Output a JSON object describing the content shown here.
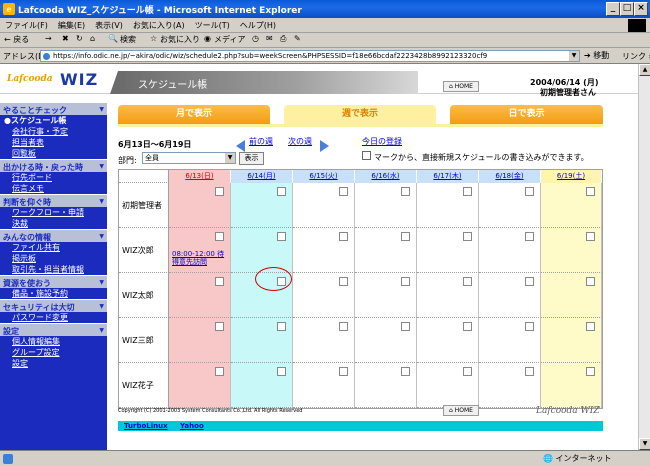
{
  "window": {
    "title": "Lafcooda WIZ_スケジュール帳 - Microsoft Internet Explorer"
  },
  "menu": [
    "ファイル(F)",
    "編集(E)",
    "表示(V)",
    "お気に入り(A)",
    "ツール(T)",
    "ヘルプ(H)"
  ],
  "toolbar": {
    "back": "← 戻る",
    "forward": "→",
    "search": "検索",
    "favorites": "お気に入り",
    "media": "メディア"
  },
  "address": {
    "label": "アドレス(D)",
    "url": "https://info.odic.ne.jp/~akira/odic/wiz/schedule2.php?sub=weekScreen&PHPSESSID=f18e66bcdaf2223428b8992123320cf9",
    "go": "移動",
    "links": "リンク »"
  },
  "header": {
    "logo_small": "Lafcooda",
    "logo_big": "WIZ",
    "page_title": "スケジュール帳",
    "home": "HOME",
    "date": "2004/06/14 (月)",
    "user": "初期管理者さん"
  },
  "sidebar": [
    {
      "section": "やることチェック",
      "items": [
        {
          "label": "●スケジュール帳",
          "current": true
        },
        {
          "label": "会社行事・予定"
        },
        {
          "label": "担当者表"
        },
        {
          "label": "回覧板"
        }
      ]
    },
    {
      "section": "出かける時・戻った時",
      "items": [
        {
          "label": "行先ボード"
        },
        {
          "label": "伝言メモ"
        }
      ]
    },
    {
      "section": "判断を仰ぐ時",
      "items": [
        {
          "label": "ワークフロー・申請"
        },
        {
          "label": "決裁"
        }
      ]
    },
    {
      "section": "みんなの情報",
      "items": [
        {
          "label": "ファイル共有"
        },
        {
          "label": "掲示板"
        },
        {
          "label": "取引先・担当者情報"
        }
      ]
    },
    {
      "section": "資源を使おう",
      "items": [
        {
          "label": "備品・施設予約"
        }
      ]
    },
    {
      "section": "セキュリティは大切",
      "items": [
        {
          "label": "パスワード変更"
        }
      ]
    },
    {
      "section": "設定",
      "items": [
        {
          "label": "個人情報編集"
        },
        {
          "label": "グループ設定"
        },
        {
          "label": "設定"
        }
      ]
    }
  ],
  "tabs": {
    "month": "月で表示",
    "week": "週で表示",
    "day": "日で表示"
  },
  "controls": {
    "date_range": "6月13日～6月19日",
    "prev_week": "前の週",
    "next_week": "次の週",
    "today_register": "今日の登録",
    "dept_label": "部門:",
    "dept_value": "全員",
    "show": "表示",
    "hint": "マークから、直接新規スケジュールの書き込みができます。"
  },
  "grid": {
    "days": [
      {
        "label": "6/13(日)",
        "bg": "#f8c8c8",
        "hdr": "#f8c8c8",
        "fg": "#d00000"
      },
      {
        "label": "6/14(月)",
        "bg": "#c8f8f8",
        "hdr": "#c8e0f8",
        "fg": "#0000d0"
      },
      {
        "label": "6/15(火)",
        "bg": "#ffffff",
        "hdr": "#c8e0f8",
        "fg": "#0000d0"
      },
      {
        "label": "6/16(水)",
        "bg": "#ffffff",
        "hdr": "#c8e0f8",
        "fg": "#0000d0"
      },
      {
        "label": "6/17(木)",
        "bg": "#ffffff",
        "hdr": "#c8e0f8",
        "fg": "#0000d0"
      },
      {
        "label": "6/18(金)",
        "bg": "#ffffff",
        "hdr": "#c8e0f8",
        "fg": "#0000d0"
      },
      {
        "label": "6/19(土)",
        "bg": "#fffbc8",
        "hdr": "#fff4b0",
        "fg": "#0000d0"
      }
    ],
    "users": [
      "初期管理者",
      "WIZ次郎",
      "WIZ太郎",
      "WIZ三郎",
      "WIZ花子"
    ],
    "appointment": {
      "user": 1,
      "day": 0,
      "time": "08:00-12:00",
      "text": "得意先訪問",
      "lead": "待"
    }
  },
  "footer": {
    "copyright": "Copyright (C) 2001-2003 System Consultants Co.,Ltd. All Rights Reserved",
    "logo": "Lafcooda WIZ",
    "links": [
      "TurboLinux",
      "Yahoo"
    ]
  },
  "status": {
    "zone": "インターネット"
  }
}
